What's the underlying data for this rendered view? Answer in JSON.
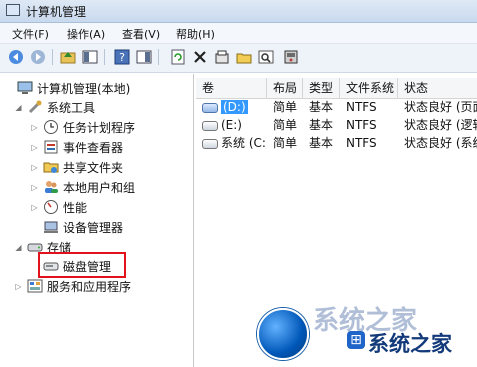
{
  "window": {
    "title": "计算机管理"
  },
  "menu": [
    "文件(F)",
    "操作(A)",
    "查看(V)",
    "帮助(H)"
  ],
  "toolbar": {
    "buttons": [
      "back-icon",
      "forward-icon",
      "up-folder-icon",
      "console-tree-icon",
      "help-icon",
      "panel-icon",
      "refresh-icon",
      "delete-icon",
      "properties-icon",
      "open-icon",
      "find-icon",
      "disk-icon"
    ]
  },
  "tree": [
    {
      "label": "计算机管理(本地)",
      "icon": "computer-icon",
      "toggle": ""
    },
    {
      "label": "系统工具",
      "icon": "tools-icon",
      "toggle": "◢"
    },
    {
      "label": "任务计划程序",
      "icon": "clock-icon",
      "toggle": "▷"
    },
    {
      "label": "事件查看器",
      "icon": "event-viewer-icon",
      "toggle": "▷"
    },
    {
      "label": "共享文件夹",
      "icon": "shared-folder-icon",
      "toggle": "▷"
    },
    {
      "label": "本地用户和组",
      "icon": "users-icon",
      "toggle": "▷"
    },
    {
      "label": "性能",
      "icon": "performance-icon",
      "toggle": "▷"
    },
    {
      "label": "设备管理器",
      "icon": "device-manager-icon",
      "toggle": ""
    },
    {
      "label": "存储",
      "icon": "storage-icon",
      "toggle": "◢"
    },
    {
      "label": "磁盘管理",
      "icon": "disk-management-icon",
      "toggle": ""
    },
    {
      "label": "服务和应用程序",
      "icon": "services-icon",
      "toggle": "▷"
    }
  ],
  "table": {
    "columns": [
      "卷",
      "布局",
      "类型",
      "文件系统",
      "状态"
    ],
    "rows": [
      {
        "volume": "(D:)",
        "layout": "简单",
        "type": "基本",
        "fs": "NTFS",
        "status": "状态良好 (页面"
      },
      {
        "volume": "(E:)",
        "layout": "简单",
        "type": "基本",
        "fs": "NTFS",
        "status": "状态良好 (逻辑"
      },
      {
        "volume": "系统 (C:)",
        "layout": "简单",
        "type": "基本",
        "fs": "NTFS",
        "status": "状态良好 (系统"
      }
    ]
  },
  "watermark": {
    "big_text": "系统之家",
    "brand_text": "系统之家"
  },
  "colors": {
    "highlight": "#e0121a",
    "selection": "#3399ff"
  }
}
